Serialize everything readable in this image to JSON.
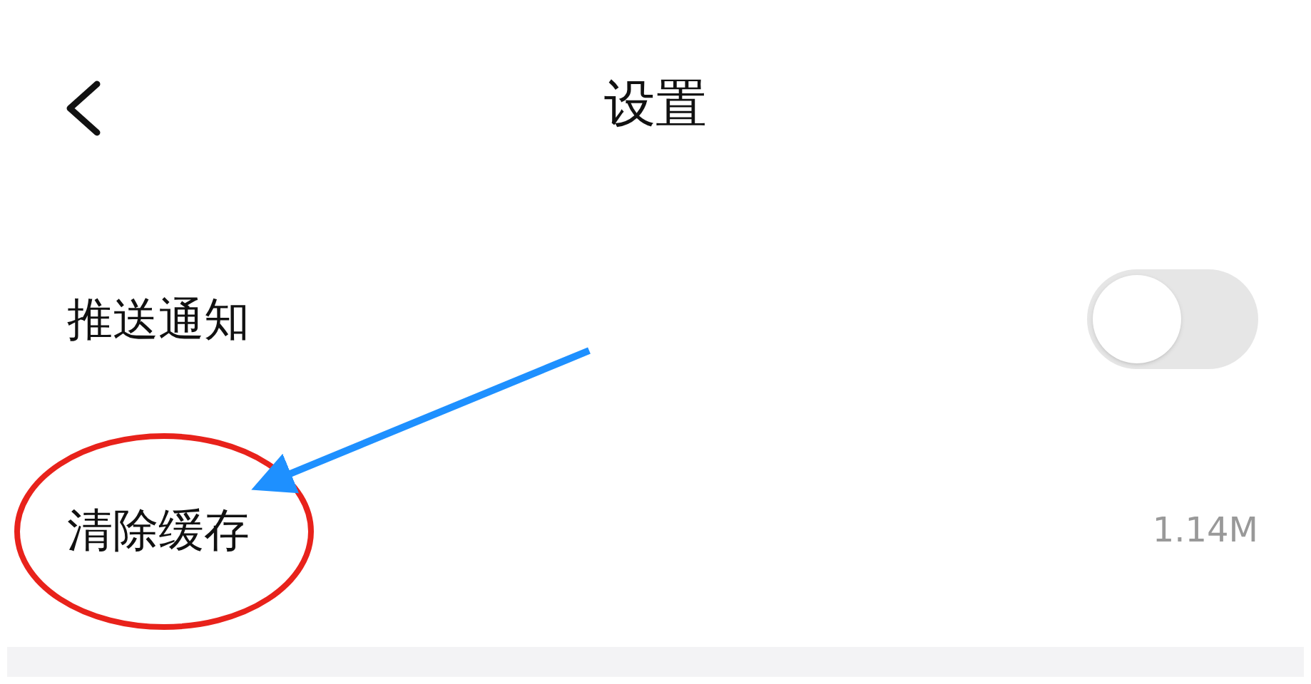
{
  "header": {
    "title": "设置"
  },
  "items": [
    {
      "kind": "toggle",
      "label": "推送通知",
      "on": false
    },
    {
      "kind": "value",
      "label": "清除缓存",
      "value": "1.14M"
    }
  ]
}
